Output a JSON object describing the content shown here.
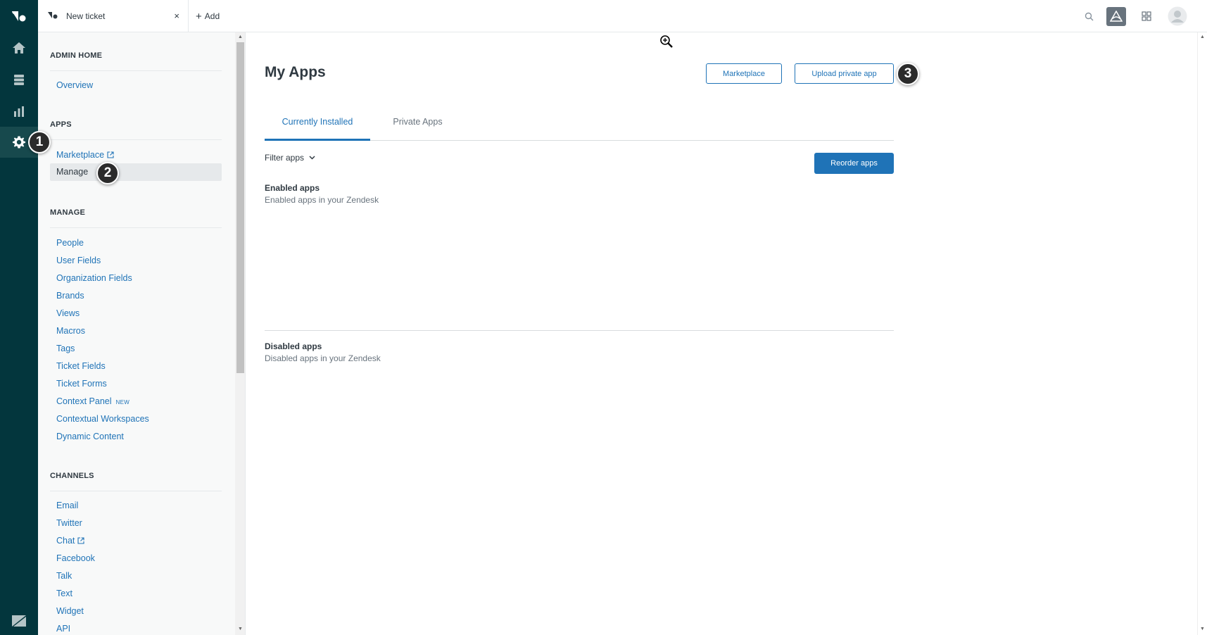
{
  "topbar": {
    "tab_title": "New ticket",
    "tab_close": "×",
    "add_label": "Add",
    "add_symbol": "+"
  },
  "sidebar": {
    "sections": {
      "admin_home": "ADMIN HOME",
      "apps": "APPS",
      "manage": "MANAGE",
      "channels": "CHANNELS"
    },
    "admin_home_items": [
      "Overview"
    ],
    "apps_items": [
      "Marketplace",
      "Manage"
    ],
    "manage_items": [
      "People",
      "User Fields",
      "Organization Fields",
      "Brands",
      "Views",
      "Macros",
      "Tags",
      "Ticket Fields",
      "Ticket Forms",
      "Context Panel",
      "Contextual Workspaces",
      "Dynamic Content"
    ],
    "new_badge": "NEW",
    "channels_items": [
      "Email",
      "Twitter",
      "Chat",
      "Facebook",
      "Talk",
      "Text",
      "Widget",
      "API"
    ]
  },
  "main": {
    "title": "My Apps",
    "marketplace_button": "Marketplace",
    "upload_button": "Upload private app",
    "tabs": [
      "Currently Installed",
      "Private Apps"
    ],
    "filter_label": "Filter apps",
    "reorder_button": "Reorder apps",
    "enabled_title": "Enabled apps",
    "enabled_sub": "Enabled apps in your Zendesk",
    "disabled_title": "Disabled apps",
    "disabled_sub": "Disabled apps in your Zendesk"
  },
  "steps": [
    "1",
    "2",
    "3"
  ],
  "icons": {
    "rail": [
      "zendesk-logo-icon",
      "home-icon",
      "views-icon",
      "reporting-icon",
      "admin-gear-icon",
      "zendesk-z-icon"
    ],
    "topbar": [
      "search-icon",
      "sell-icon",
      "products-grid-icon",
      "user-avatar-icon"
    ]
  },
  "colors": {
    "rail": "#03363d",
    "accent": "#1f73b7",
    "text": "#2f3941",
    "muted": "#68737d"
  }
}
